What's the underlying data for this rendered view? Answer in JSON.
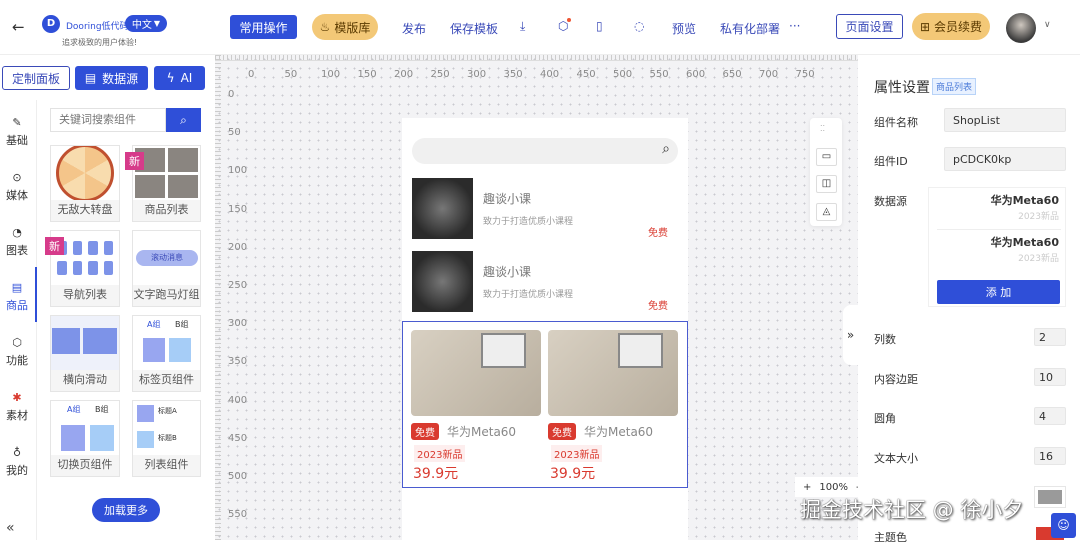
{
  "header": {
    "brand": "Dooring低代码",
    "slogan": "追求极致的用户体验!",
    "lang": "中文",
    "common_ops": "常用操作",
    "templates": "模版库",
    "publish": "发布",
    "save_template": "保存模板",
    "preview": "预览",
    "private_deploy": "私有化部署",
    "more": "···",
    "page_settings": "页面设置",
    "membership": "会员续费"
  },
  "toolbar": {
    "custom_panel": "定制面板",
    "datasource": "数据源",
    "ai": "AI"
  },
  "leftnav": {
    "items": [
      {
        "label": "基础",
        "icon": "brush-icon"
      },
      {
        "label": "媒体",
        "icon": "play-icon"
      },
      {
        "label": "图表",
        "icon": "pie-chart-icon"
      },
      {
        "label": "商品",
        "icon": "shop-icon"
      },
      {
        "label": "功能",
        "icon": "cube-icon"
      },
      {
        "label": "素材",
        "icon": "material-icon"
      },
      {
        "label": "我的",
        "icon": "user-icon"
      }
    ],
    "active": "商品",
    "collapse": "«"
  },
  "panel": {
    "search_placeholder": "关键词搜索组件",
    "new_tag": "新",
    "components": [
      "无敌大转盘",
      "商品列表",
      "导航列表",
      "文字跑马灯组",
      "横向滑动",
      "标签页组件",
      "切换页组件",
      "列表组件"
    ],
    "marquee_text": "滚动消息",
    "tab_a": "A组",
    "tab_b": "B组",
    "title_a": "标题A",
    "title_b": "标题B",
    "load_more": "加载更多"
  },
  "ruler": {
    "x": [
      "0",
      "50",
      "100",
      "150",
      "200",
      "250",
      "300",
      "350",
      "400",
      "450",
      "500",
      "550",
      "600",
      "650",
      "700",
      "750"
    ],
    "y": [
      "0",
      "50",
      "100",
      "150",
      "200",
      "250",
      "300",
      "350",
      "400",
      "450",
      "500",
      "550"
    ]
  },
  "phone": {
    "courses": [
      {
        "title": "趣谈小课",
        "desc": "致力于打造优质小课程",
        "price": "免费"
      },
      {
        "title": "趣谈小课",
        "desc": "致力于打造优质小课程",
        "price": "免费"
      }
    ],
    "products": [
      {
        "badge": "免费",
        "name": "华为Meta60",
        "tag": "2023新品",
        "price": "39.9元"
      },
      {
        "badge": "免费",
        "name": "华为Meta60",
        "tag": "2023新品",
        "price": "39.9元"
      }
    ]
  },
  "zoombar": {
    "plus": "+",
    "zoom": "100%",
    "minus": "-"
  },
  "props": {
    "title": "属性设置",
    "badge": "商品列表",
    "name_label": "组件名称",
    "name_value": "ShopList",
    "id_label": "组件ID",
    "id_value": "pCDCK0kp",
    "ds_label": "数据源",
    "ds_items": [
      {
        "title": "华为Meta60",
        "sub": "2023新品"
      },
      {
        "title": "华为Meta60",
        "sub": "2023新品"
      }
    ],
    "add": "添 加",
    "cols_label": "列数",
    "cols": "2",
    "padding_label": "内容边距",
    "padding": "10",
    "radius_label": "圆角",
    "radius": "4",
    "fontsize_label": "文本大小",
    "fontsize": "16",
    "theme_label": "主题色",
    "colors": {
      "gray": "#9a9a9a",
      "theme": "#d93a2f"
    }
  },
  "watermark": "掘金技术社区 @ 徐小夕",
  "colors": {
    "primary": "#2f4fd8",
    "gold": "#f3c877",
    "red": "#d93a2f"
  }
}
